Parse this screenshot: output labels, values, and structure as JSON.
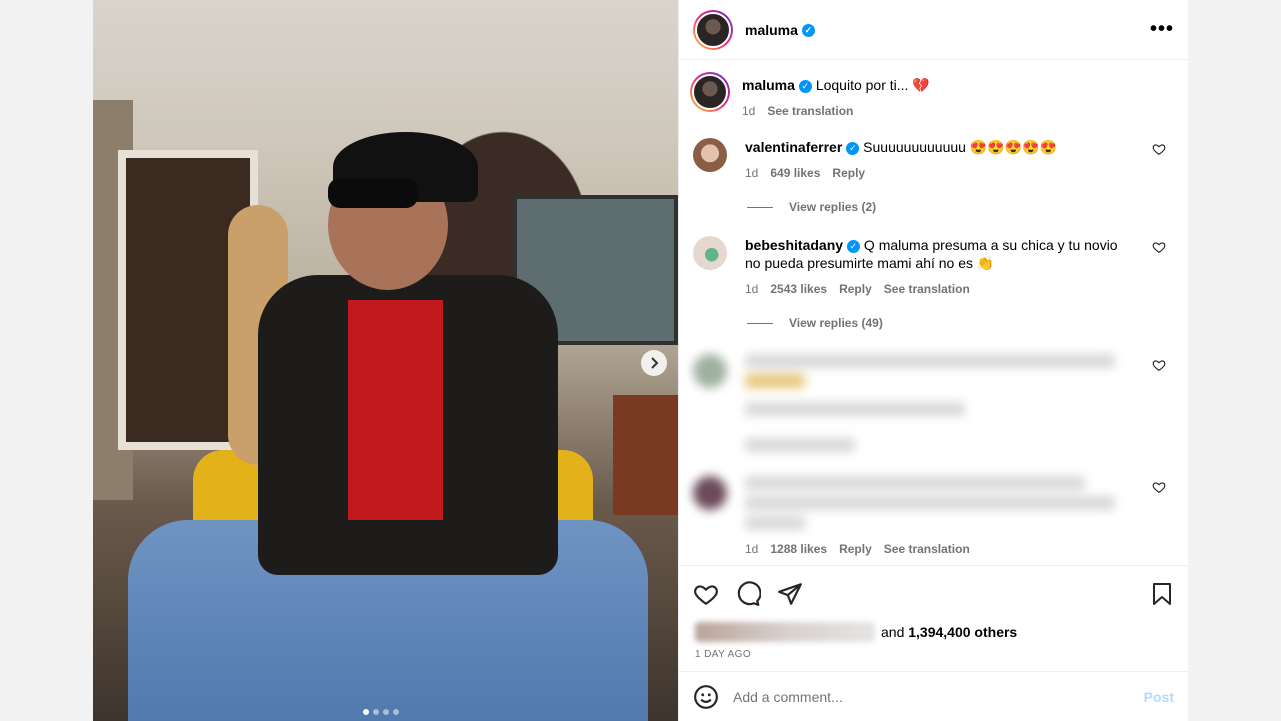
{
  "post": {
    "username": "maluma",
    "verified_mark": "✓",
    "more_label": "•••",
    "caption_user": "maluma",
    "caption_text": "Loquito por ti... 💔",
    "caption_time": "1d",
    "caption_translate": "See translation",
    "carousel_dot_count": 4,
    "carousel_active_index": 0
  },
  "comments": [
    {
      "user": "valentinaferrer",
      "text": "Suuuuuuuuuuuu 😍😍😍😍😍",
      "time": "1d",
      "likes": "649 likes",
      "reply": "Reply",
      "view_replies": "View replies (2)",
      "avatar_color": "#c7a28c"
    },
    {
      "user": "bebeshitadany",
      "text": "Q maluma presuma a su chica y tu novio no pueda presumirte mami ahí no es 👏",
      "time": "1d",
      "likes": "2543 likes",
      "reply": "Reply",
      "translate": "See translation",
      "view_replies": "View replies (49)",
      "avatar_color": "#d9c9bf"
    },
    {
      "time": "1d",
      "likes": "1288 likes",
      "reply": "Reply",
      "translate": "See translation"
    }
  ],
  "likes": {
    "suffix_and": "and",
    "count": "1,394,400 others"
  },
  "date_label": "1 DAY AGO",
  "add_comment": {
    "placeholder": "Add a comment...",
    "post_label": "Post"
  },
  "colors": {
    "accent": "#0095f6",
    "post_disabled": "#b3dbff",
    "meta_gray": "#737373"
  },
  "icons": [
    "heart-icon",
    "comment-icon",
    "share-icon",
    "bookmark-icon",
    "emoji-icon",
    "chevron-right-icon",
    "more-icon",
    "verified-icon"
  ]
}
